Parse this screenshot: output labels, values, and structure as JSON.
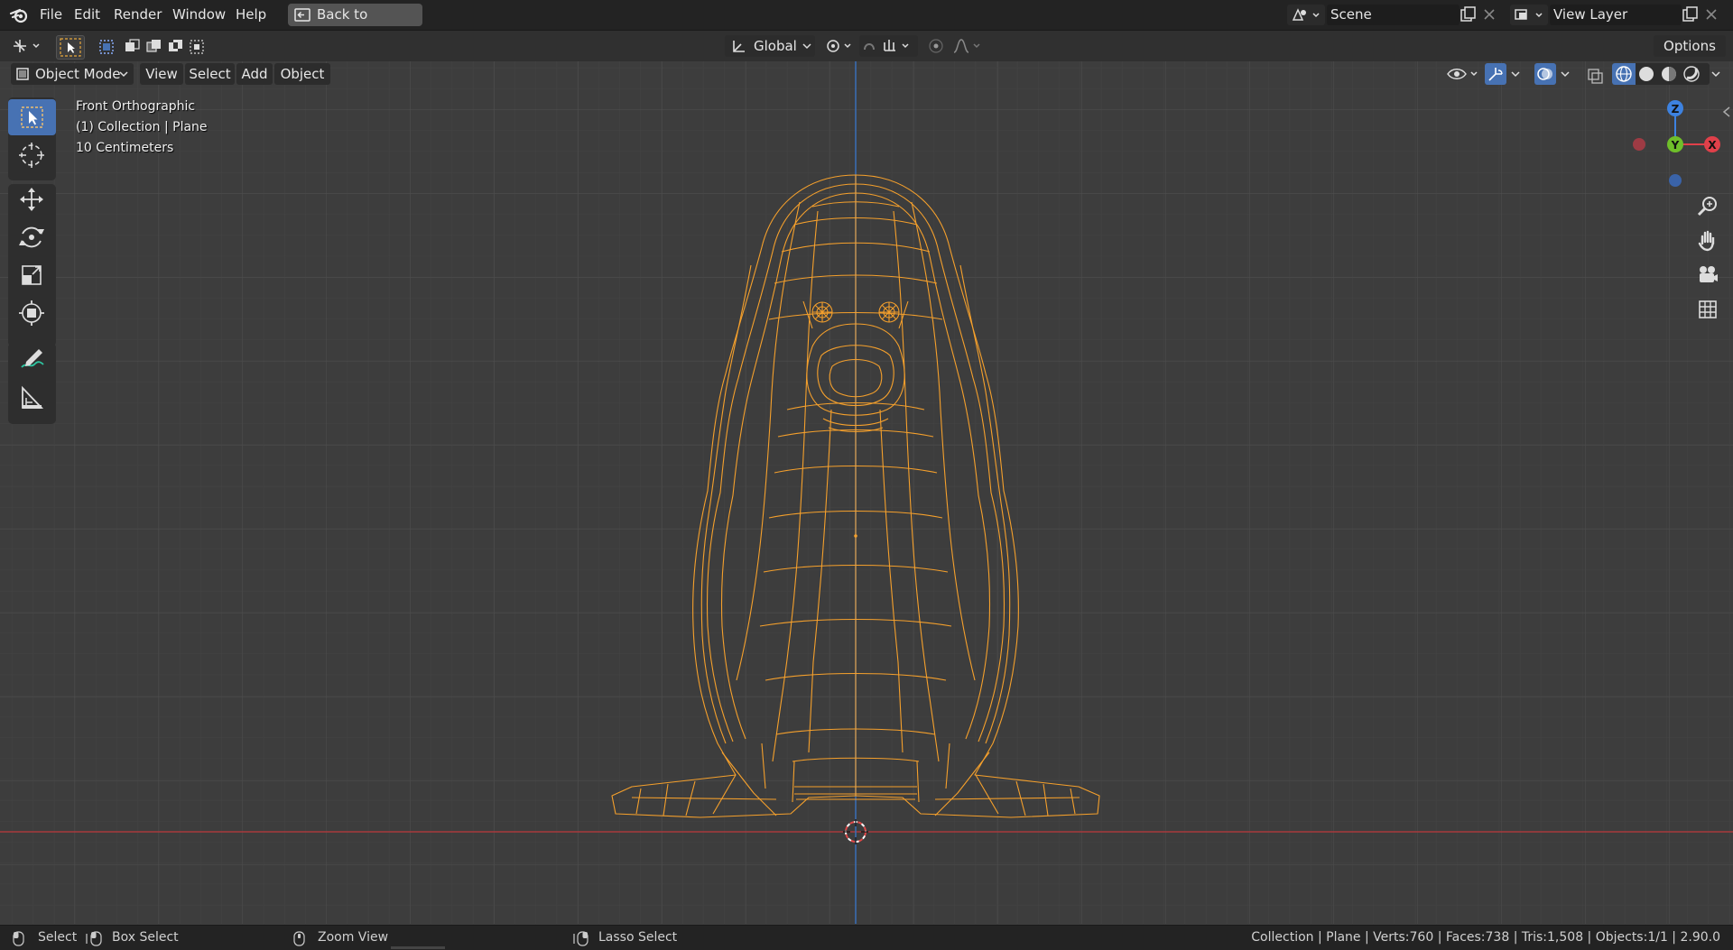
{
  "topbar": {
    "menus": [
      "File",
      "Edit",
      "Render",
      "Window",
      "Help"
    ],
    "back_label": "Back to Previous",
    "scene_name": "Scene",
    "view_layer_name": "View Layer"
  },
  "toolheader": {
    "orientation": "Global",
    "options_label": "Options"
  },
  "viewport_header": {
    "mode": "Object Mode",
    "menus": [
      "View",
      "Select",
      "Add",
      "Object"
    ]
  },
  "overlay": {
    "view_name": "Front Orthographic",
    "collection_info": "(1) Collection | Plane",
    "scale": "10 Centimeters"
  },
  "gizmo": {
    "axis_z": "Z",
    "axis_y": "Y",
    "axis_x": "X"
  },
  "statusbar": {
    "select": "Select",
    "box_select": "Box Select",
    "zoom_view": "Zoom View",
    "lasso_select": "Lasso Select",
    "stats": "Collection | Plane | Verts:760 | Faces:738 | Tris:1,508 | Objects:1/1 | 2.90.0"
  },
  "colors": {
    "wireframe": "#f5a02c",
    "accent": "#4772b3",
    "x_axis": "#e0404a",
    "y_axis": "#6fbf2a",
    "z_axis": "#3d82e0"
  }
}
